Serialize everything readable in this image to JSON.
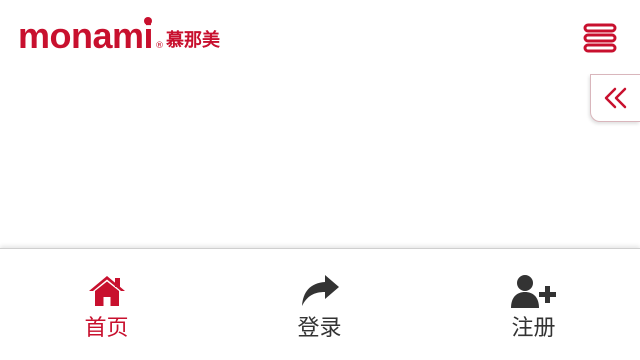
{
  "brand": {
    "logo_text": "monami",
    "logo_registered": "®",
    "logo_chinese": "慕那美",
    "color": "#c8102e"
  },
  "header": {
    "menu_icon": "hamburger-menu-icon"
  },
  "side_tab": {
    "icon": "double-chevron-left-icon"
  },
  "bottom_nav": {
    "items": [
      {
        "label": "首页",
        "icon": "home-icon",
        "active": true
      },
      {
        "label": "登录",
        "icon": "share-arrow-icon",
        "active": false
      },
      {
        "label": "注册",
        "icon": "user-plus-icon",
        "active": false
      }
    ],
    "active_color": "#c8102e",
    "inactive_color": "#333333"
  }
}
